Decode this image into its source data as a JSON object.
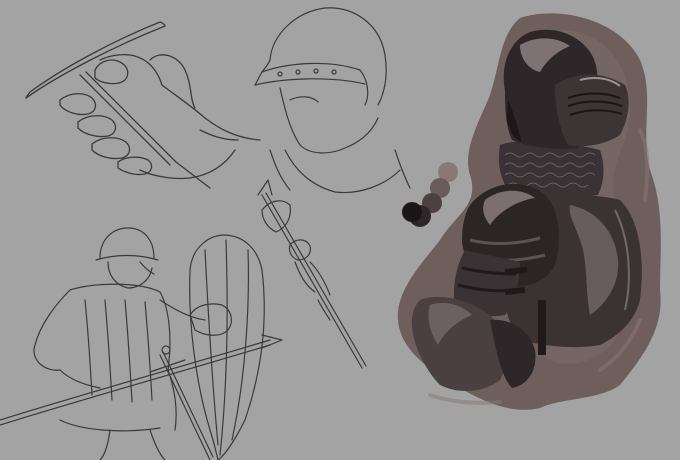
{
  "canvas": {
    "background": "#a3a3a3",
    "sketch_line_color": "#3a3a3a",
    "painting_bg_color": "#6e5f5c",
    "armor_shadow_color": "#2b2526",
    "armor_mid_color": "#4a3f41",
    "armor_highlight_color": "#8a7c7d"
  },
  "swatches": {
    "colors": [
      "#8a7876",
      "#6a5b5a",
      "#4c4142",
      "#2e2729",
      "#1a1617"
    ]
  },
  "sketches": [
    {
      "name": "hand-gripping-shield-sketch"
    },
    {
      "name": "helmet-sketch"
    },
    {
      "name": "poleaxe-soldier-sketch"
    },
    {
      "name": "soldier-with-shield-and-spear-sketch"
    }
  ],
  "painting": {
    "name": "armored-knight-painting"
  }
}
